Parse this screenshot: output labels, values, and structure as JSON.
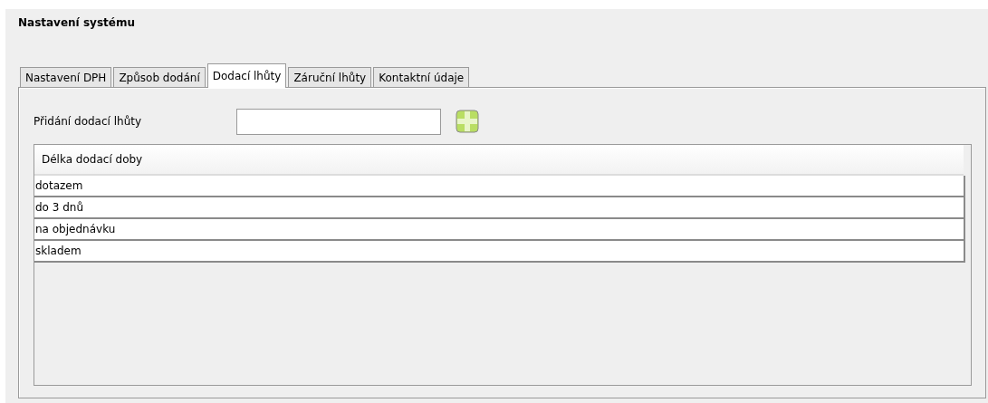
{
  "title": "Nastavení systému",
  "tabs": [
    {
      "label": "Nastavení DPH",
      "selected": false
    },
    {
      "label": "Způsob dodání",
      "selected": false
    },
    {
      "label": "Dodací lhůty",
      "selected": true
    },
    {
      "label": "Záruční lhůty",
      "selected": false
    },
    {
      "label": "Kontaktní údaje",
      "selected": false
    }
  ],
  "add_field": {
    "label": "Přidání dodací lhůty"
  },
  "table": {
    "columns": [
      "Délka dodací doby"
    ],
    "rows": [
      [
        "dotazem"
      ],
      [
        "do 3 dnů"
      ],
      [
        "na objednávku"
      ],
      [
        "skladem"
      ]
    ]
  }
}
